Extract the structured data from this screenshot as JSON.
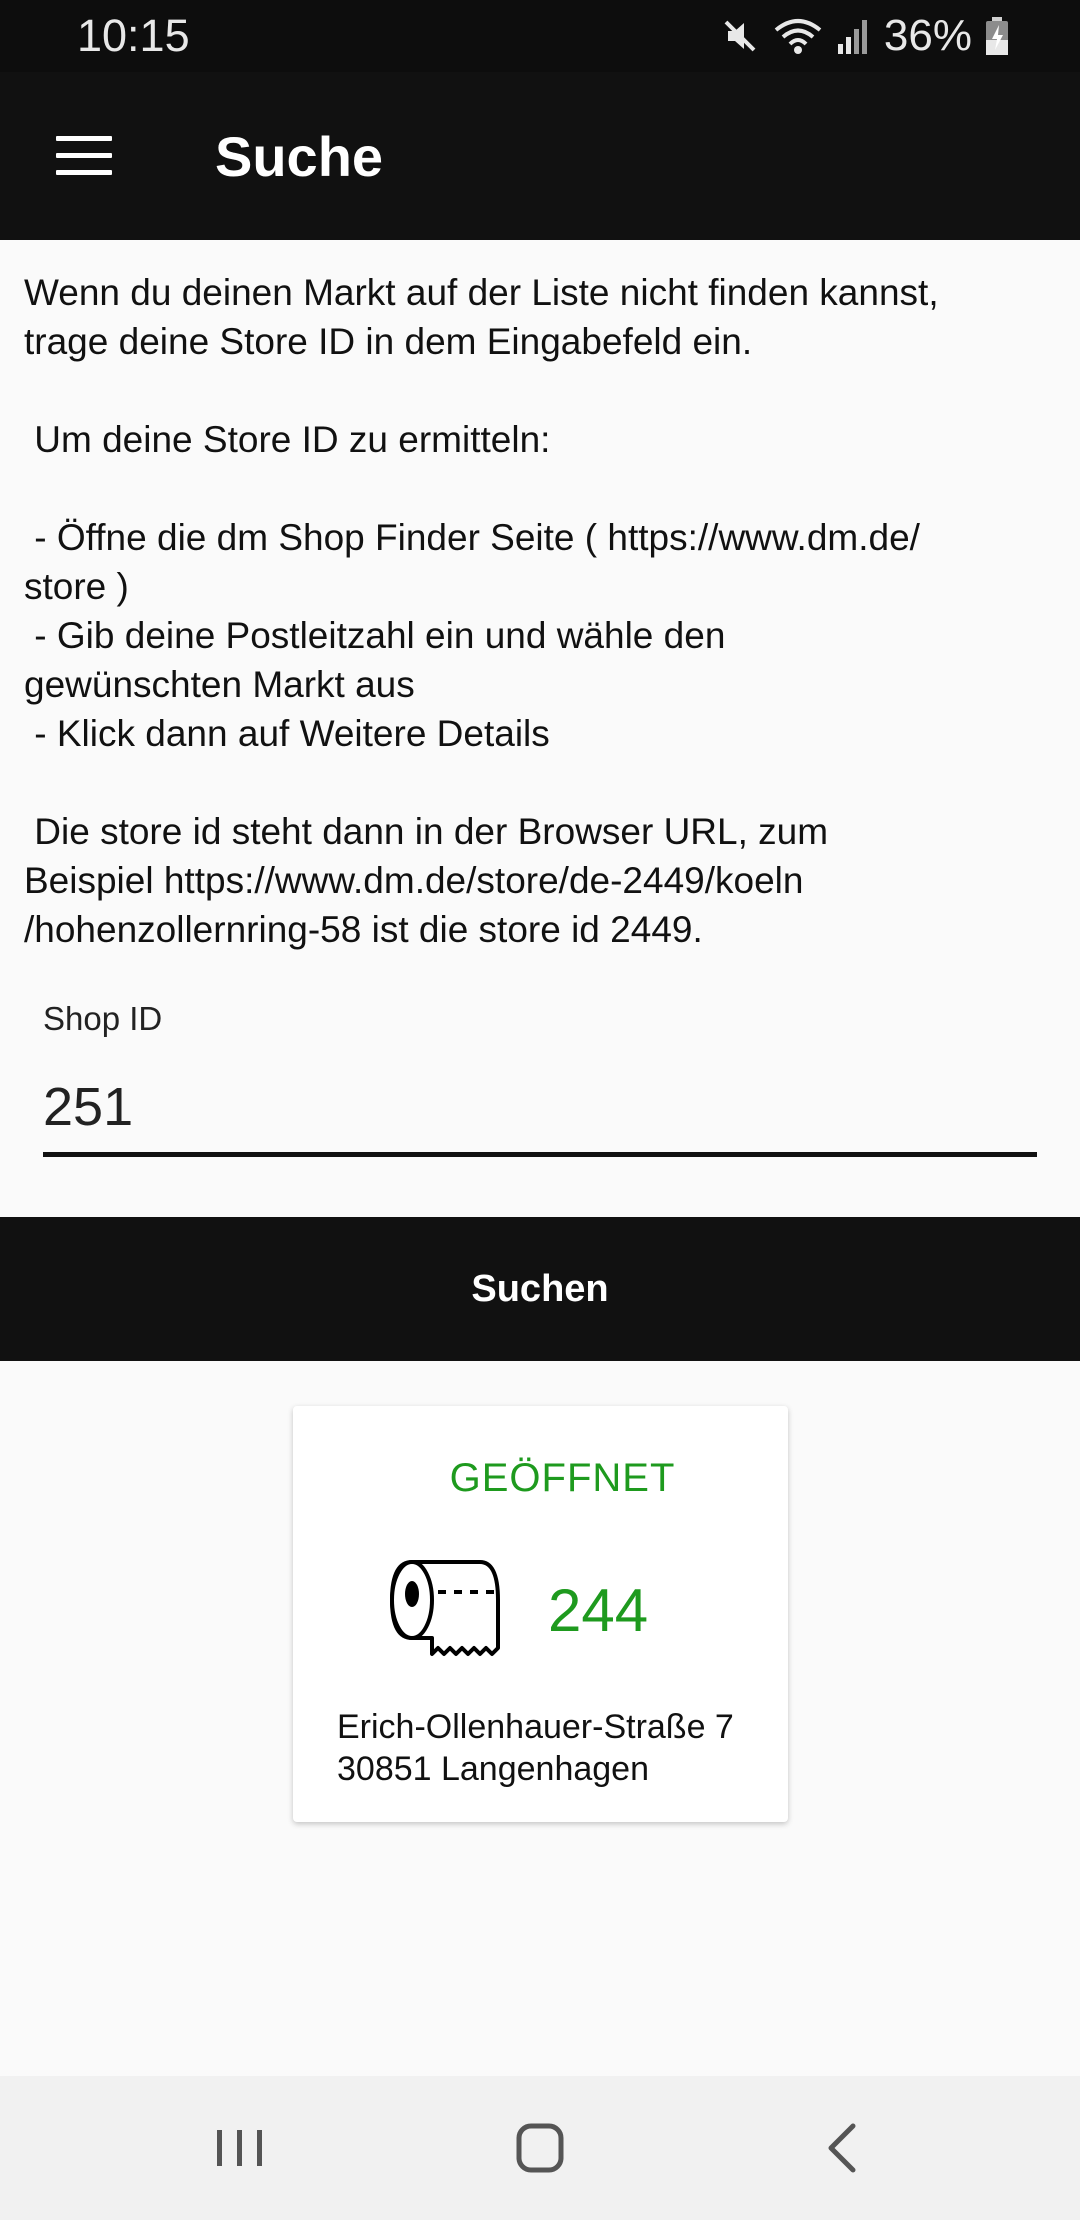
{
  "status_bar": {
    "time": "10:15",
    "battery": "36%",
    "icons": [
      "mute-icon",
      "wifi-icon",
      "signal-icon",
      "battery-charging-icon"
    ]
  },
  "app_bar": {
    "title": "Suche",
    "menu_icon": "hamburger-menu-icon"
  },
  "info": {
    "lines": [
      "Wenn du deinen Markt auf der Liste nicht finden kannst,",
      "trage deine Store ID in dem Eingabefeld ein.",
      "",
      " Um deine Store ID zu ermitteln:",
      "",
      " - Öffne die dm Shop Finder Seite ( https://www.dm.de/",
      "store )",
      " - Gib deine Postleitzahl ein und wähle den",
      "gewünschten Markt aus",
      " - Klick dann auf Weitere Details",
      "",
      " Die store id steht dann in der Browser URL, zum",
      "Beispiel https://www.dm.de/store/de-2449/koeln",
      "/hohenzollernring-58 ist die store id 2449."
    ]
  },
  "shop_id_field": {
    "label": "Shop ID",
    "value": "251"
  },
  "search_button": {
    "label": "Suchen"
  },
  "result_card": {
    "status": "GEÖFFNET",
    "status_color": "#1e9a1e",
    "icon": "toilet-paper-icon",
    "count": "244",
    "count_color": "#1e9a1e",
    "address_line1": "Erich-Ollenhauer-Straße 7",
    "address_line2": "30851 Langenhagen"
  },
  "nav_bar": {
    "recent_icon": "recent-apps-icon",
    "home_icon": "home-icon",
    "back_icon": "back-icon"
  }
}
